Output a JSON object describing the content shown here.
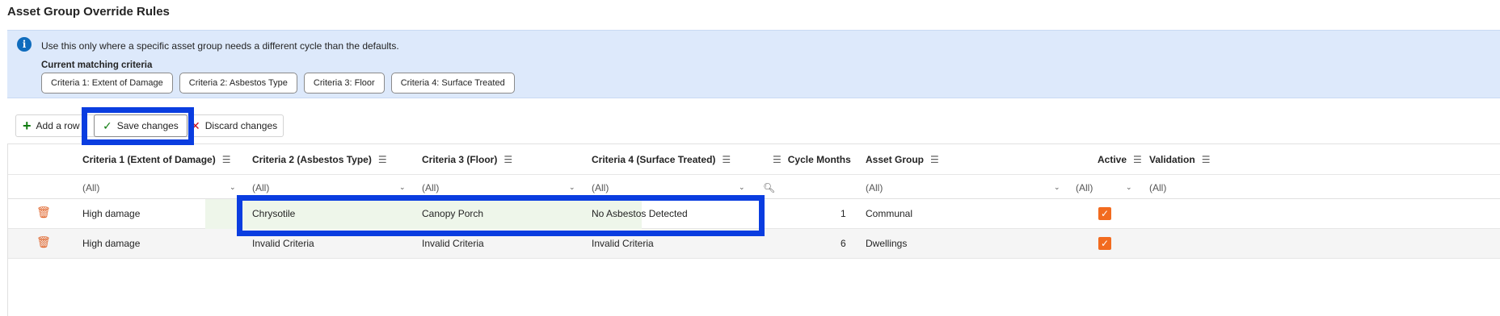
{
  "page_title": "Asset Group Override Rules",
  "info": {
    "message": "Use this only where a specific asset group needs a different cycle than the defaults.",
    "criteria_label": "Current matching criteria",
    "criteria": [
      "Criteria 1: Extent of Damage",
      "Criteria 2: Asbestos Type",
      "Criteria 3: Floor",
      "Criteria 4: Surface Treated"
    ]
  },
  "toolbar": {
    "add_label": "Add a row",
    "save_label": "Save changes",
    "discard_label": "Discard changes"
  },
  "columns": {
    "c1": "Criteria 1 (Extent of Damage)",
    "c2": "Criteria 2 (Asbestos Type)",
    "c3": "Criteria 3 (Floor)",
    "c4": "Criteria 4 (Surface Treated)",
    "cycle": "Cycle Months",
    "group": "Asset Group",
    "active": "Active",
    "validation": "Validation"
  },
  "filters": {
    "all": "(All)"
  },
  "rows": [
    {
      "c1": "High damage",
      "c2": "Chrysotile",
      "c3": "Canopy Porch",
      "c4": "No Asbestos Detected",
      "cycle": "1",
      "group": "Communal",
      "active": true
    },
    {
      "c1": "High damage",
      "c2": "Invalid Criteria",
      "c3": "Invalid Criteria",
      "c4": "Invalid Criteria",
      "cycle": "6",
      "group": "Dwellings",
      "active": true
    }
  ],
  "colors": {
    "accent": "#0f6cbd",
    "checkbox": "#f26b1f",
    "trash": "#e0642a",
    "highlight": "#0a3de0"
  }
}
